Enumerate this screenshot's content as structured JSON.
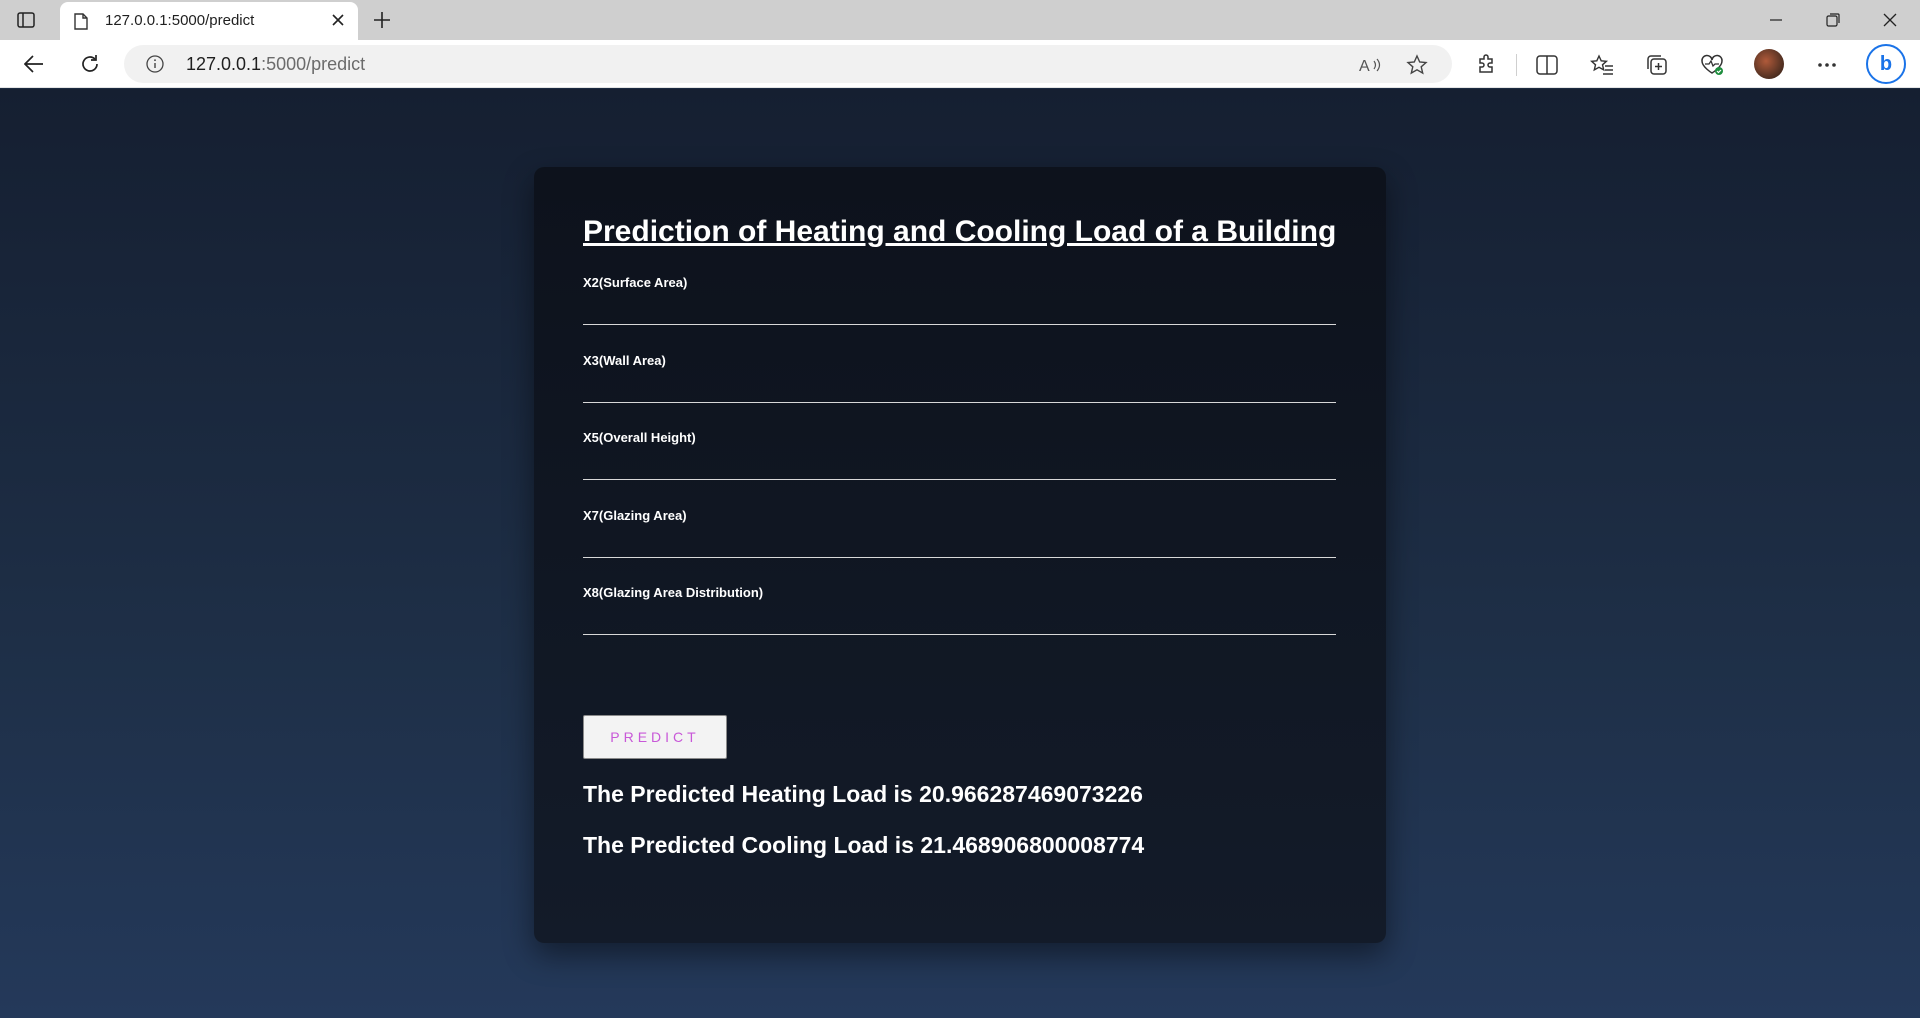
{
  "browser": {
    "tab_title": "127.0.0.1:5000/predict",
    "url_host": "127.0.0.1",
    "url_rest": ":5000/predict"
  },
  "page": {
    "title": "Prediction of Heating and Cooling Load of a Building",
    "fields": [
      {
        "label": "X2(Surface Area)",
        "value": ""
      },
      {
        "label": "X3(Wall Area)",
        "value": ""
      },
      {
        "label": "X5(Overall Height)",
        "value": ""
      },
      {
        "label": "X7(Glazing Area)",
        "value": ""
      },
      {
        "label": "X8(Glazing Area Distribution)",
        "value": ""
      }
    ],
    "predict_label": "PREDICT",
    "heating_result": "The Predicted Heating Load is 20.966287469073226",
    "cooling_result": "The Predicted Cooling Load is 21.468906800008774"
  }
}
